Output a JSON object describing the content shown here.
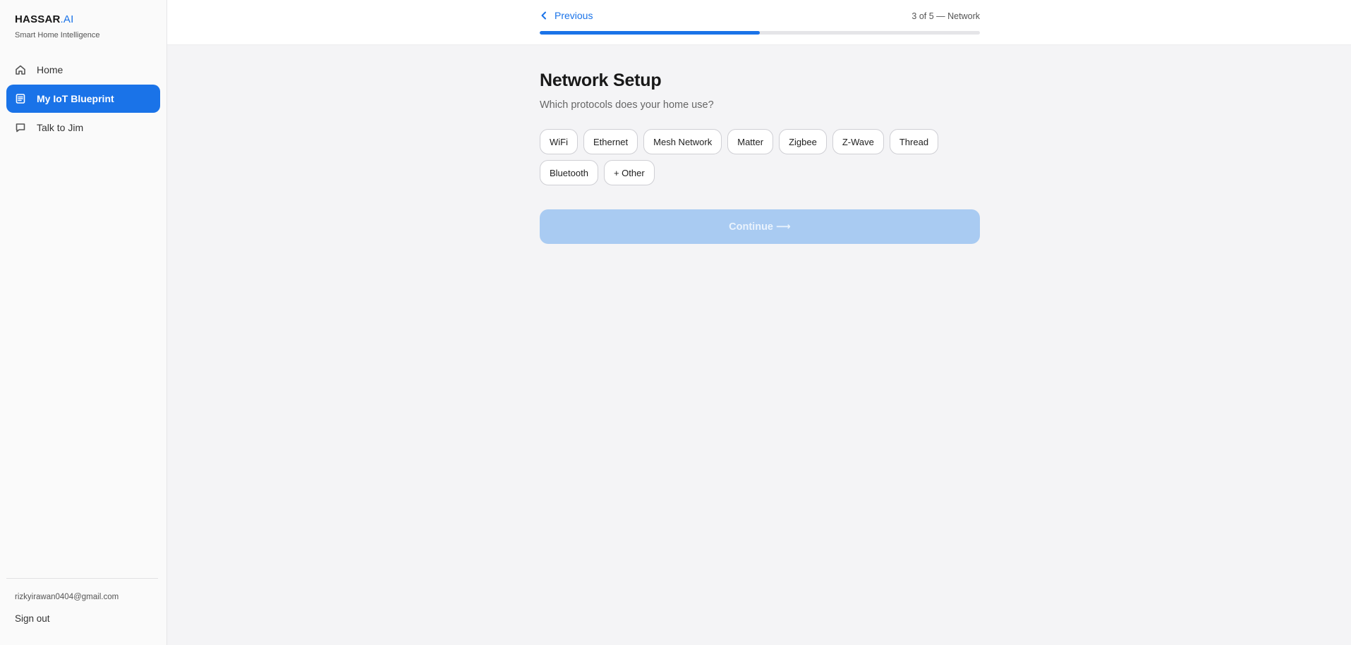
{
  "brand": {
    "name": "HASSAR",
    "accent": ".AI",
    "tagline": "Smart Home Intelligence"
  },
  "sidebar": {
    "items": [
      {
        "label": "Home",
        "icon": "home-icon",
        "active": false
      },
      {
        "label": "My IoT Blueprint",
        "icon": "document-icon",
        "active": true
      },
      {
        "label": "Talk to Jim",
        "icon": "chat-icon",
        "active": false
      }
    ],
    "user_email": "rizkyirawan0404@gmail.com",
    "sign_out": "Sign out"
  },
  "header": {
    "previous_label": "Previous",
    "step_label": "3 of 5 — Network",
    "progress_fraction": 0.5
  },
  "main": {
    "title": "Network Setup",
    "subtitle": "Which protocols does your home use?",
    "options": [
      "WiFi",
      "Ethernet",
      "Mesh Network",
      "Matter",
      "Zigbee",
      "Z-Wave",
      "Thread",
      "Bluetooth",
      "+ Other"
    ],
    "continue_label": "Continue ⟶"
  },
  "colors": {
    "accent": "#1a73e8",
    "continue_disabled": "#a9cbf2"
  }
}
